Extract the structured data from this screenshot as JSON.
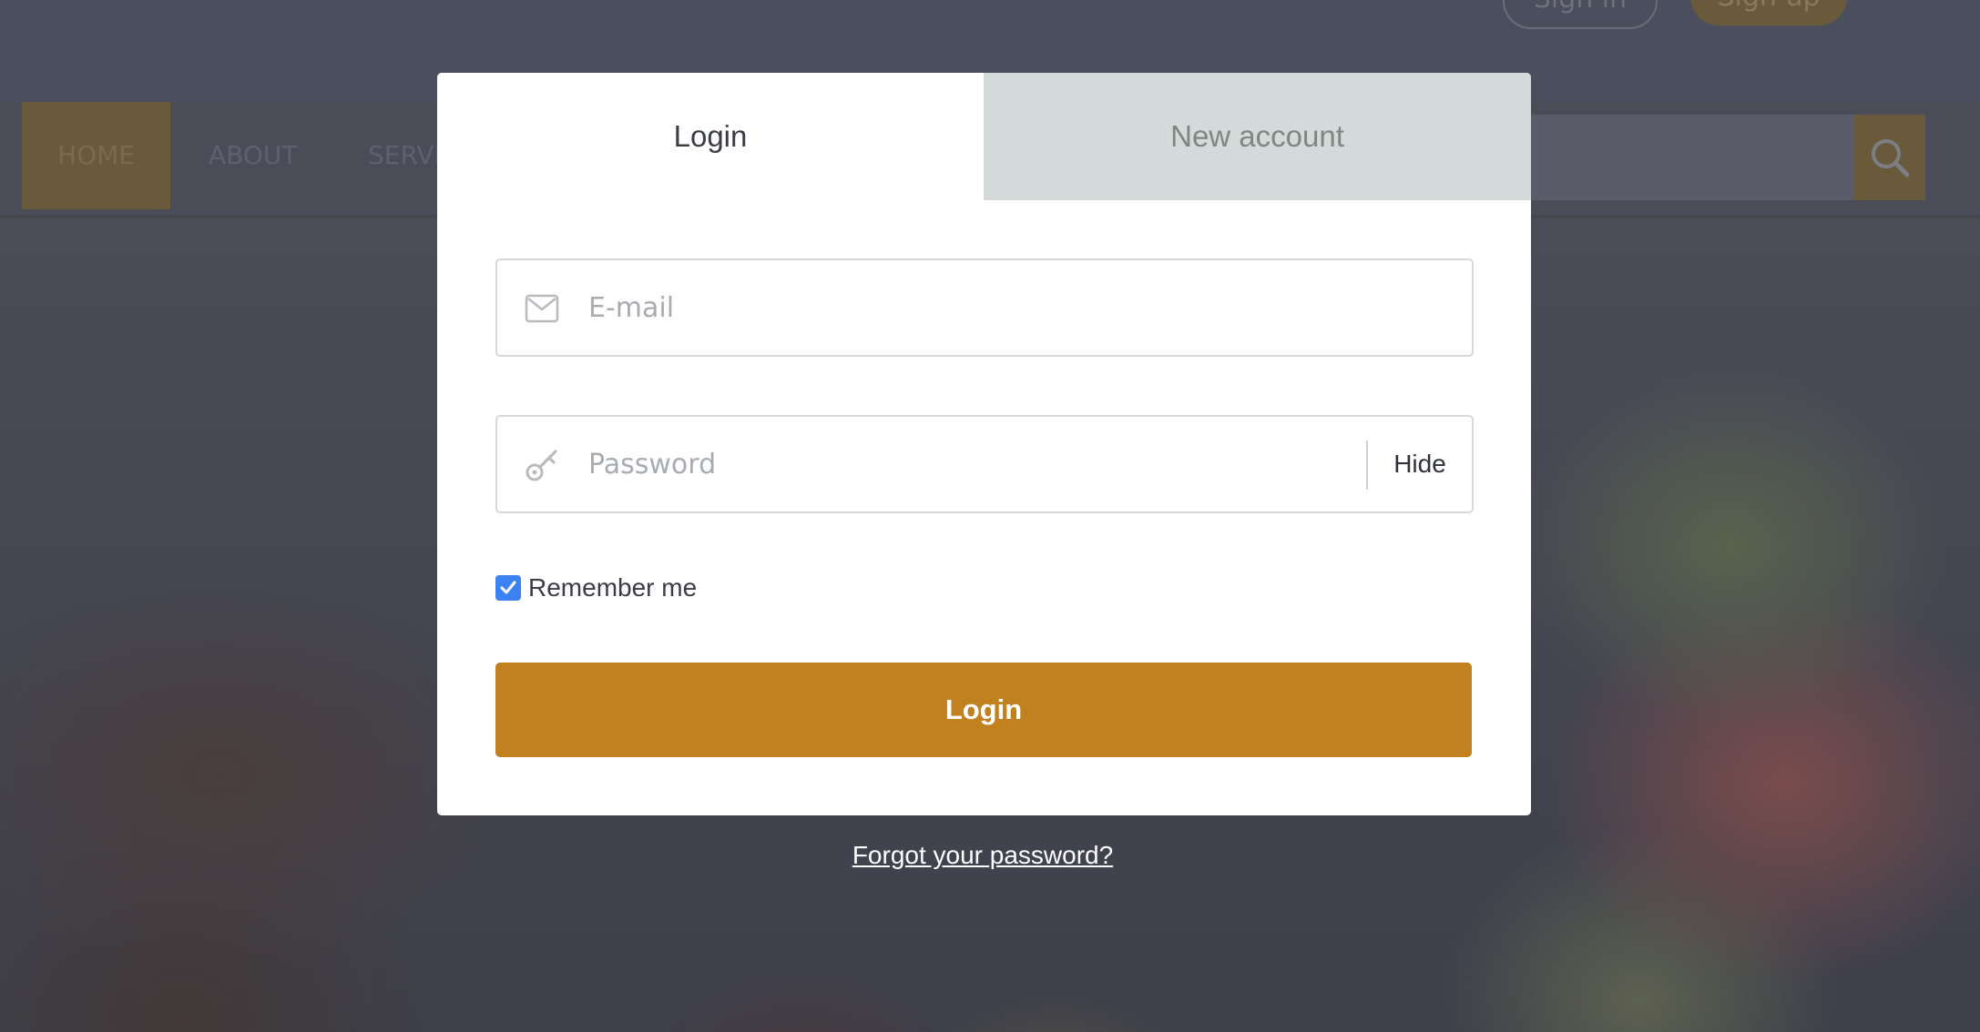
{
  "background_page": {
    "top_buttons": {
      "sign_in": "Sign in",
      "sign_up": "Sign up"
    },
    "nav": [
      "HOME",
      "ABOUT",
      "SERVI"
    ],
    "search_icon": "search-icon"
  },
  "modal": {
    "tabs": [
      {
        "label": "Login",
        "active": true
      },
      {
        "label": "New account",
        "active": false
      }
    ],
    "email": {
      "placeholder": "E-mail",
      "value": "",
      "icon": "envelope-icon"
    },
    "password": {
      "placeholder": "Password",
      "value": "",
      "icon": "key-icon",
      "toggle_label": "Hide"
    },
    "remember": {
      "label": "Remember me",
      "checked": true
    },
    "submit_label": "Login"
  },
  "forgot_password": "Forgot your password?",
  "colors": {
    "accent": "#c0811e",
    "checkbox": "#3d82f2",
    "inactive_tab": "#d4d9d9",
    "overlay": "#3a3d49"
  }
}
